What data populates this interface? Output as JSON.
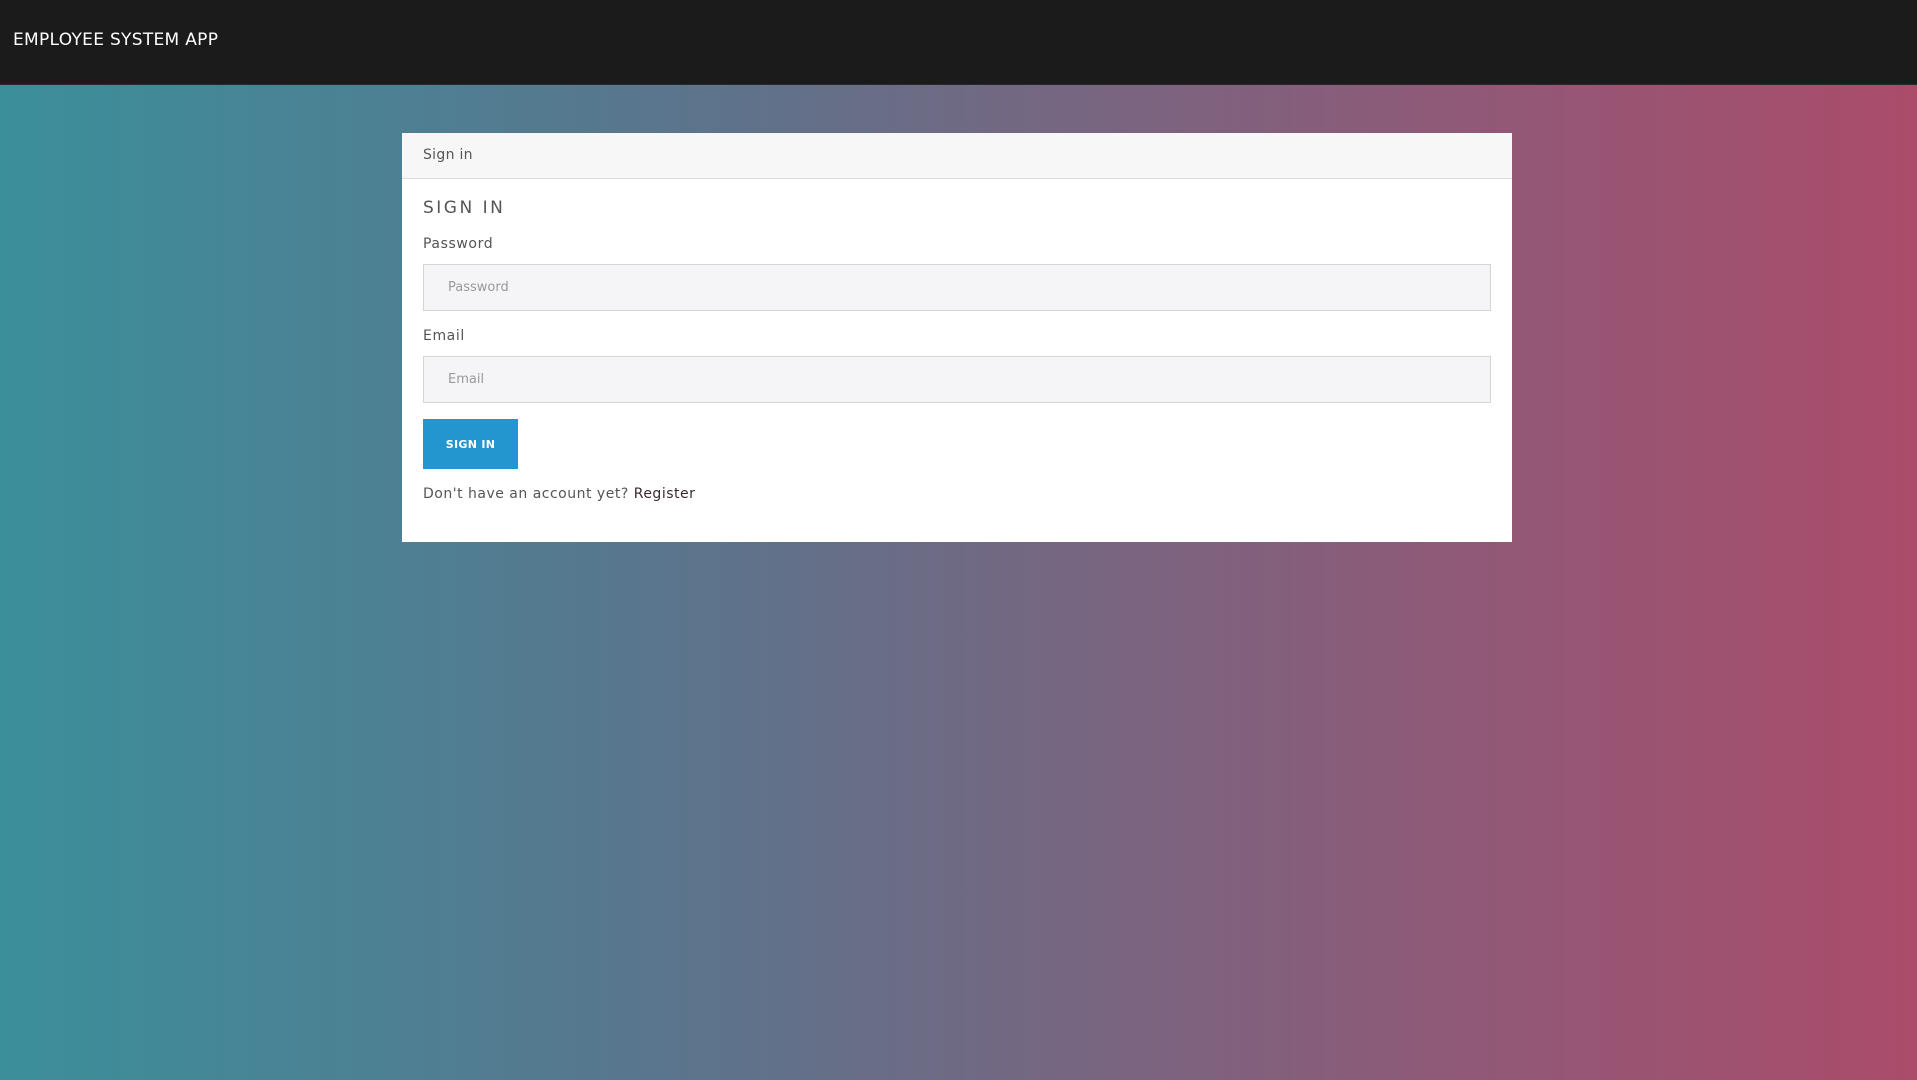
{
  "navbar": {
    "brand": "EMPLOYEE SYSTEM APP"
  },
  "card": {
    "header": "Sign in",
    "title": "SIGN IN",
    "password": {
      "label": "Password",
      "placeholder": "Password",
      "value": ""
    },
    "email": {
      "label": "Email",
      "placeholder": "Email",
      "value": ""
    },
    "submit_label": "SIGN IN",
    "register_prompt": "Don't have an account yet?",
    "register_link": "Register"
  },
  "colors": {
    "navbar_bg": "#1b1b1b",
    "button_bg": "#2396cf",
    "gradient_start": "#3b8f9b",
    "gradient_end": "#aa4c6a"
  }
}
